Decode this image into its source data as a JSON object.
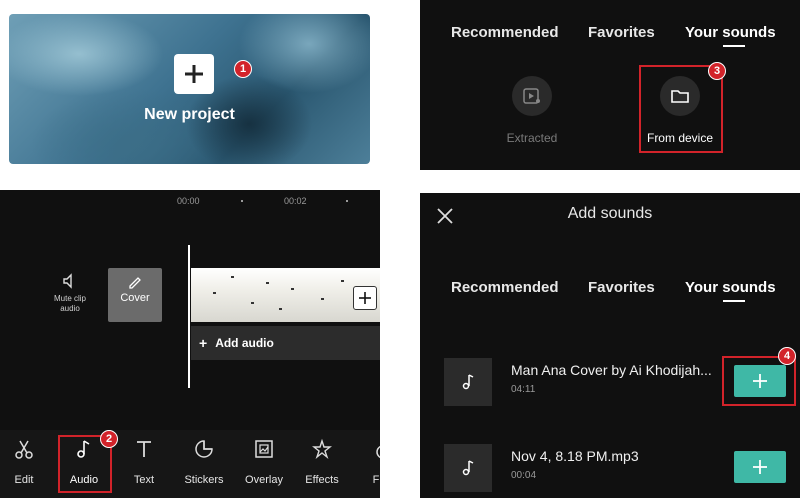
{
  "step1": {
    "title": "New project",
    "badge": "1"
  },
  "step2": {
    "timeline": {
      "ticks": [
        "00:00",
        "00:02"
      ]
    },
    "mute_label": "Mute clip audio",
    "cover_label": "Cover",
    "add_audio_label": "Add audio",
    "toolbar": [
      {
        "label": "Edit",
        "icon": "scissors-icon"
      },
      {
        "label": "Audio",
        "icon": "music-note-icon"
      },
      {
        "label": "Text",
        "icon": "text-icon"
      },
      {
        "label": "Stickers",
        "icon": "sticker-icon"
      },
      {
        "label": "Overlay",
        "icon": "overlay-icon"
      },
      {
        "label": "Effects",
        "icon": "effects-icon"
      },
      {
        "label": "Filt",
        "icon": "filters-icon"
      }
    ],
    "badge": "2"
  },
  "step3": {
    "tabs": [
      "Recommended",
      "Favorites",
      "Your sounds"
    ],
    "active_tab": "Your sounds",
    "sources": [
      {
        "label": "Extracted",
        "icon": "extracted-video-icon",
        "enabled": false
      },
      {
        "label": "From device",
        "icon": "folder-icon",
        "enabled": true
      }
    ],
    "badge": "3"
  },
  "step4": {
    "title": "Add sounds",
    "tabs": [
      "Recommended",
      "Favorites",
      "Your sounds"
    ],
    "active_tab": "Your sounds",
    "sounds": [
      {
        "name": "Man Ana Cover by Ai Khodijah...",
        "duration": "04:11"
      },
      {
        "name": "Nov 4, 8.18 PM.mp3",
        "duration": "00:04"
      }
    ],
    "badge": "4"
  },
  "colors": {
    "highlight": "#d2232a",
    "accent": "#3fb8a6",
    "panel_bg": "#101010"
  }
}
